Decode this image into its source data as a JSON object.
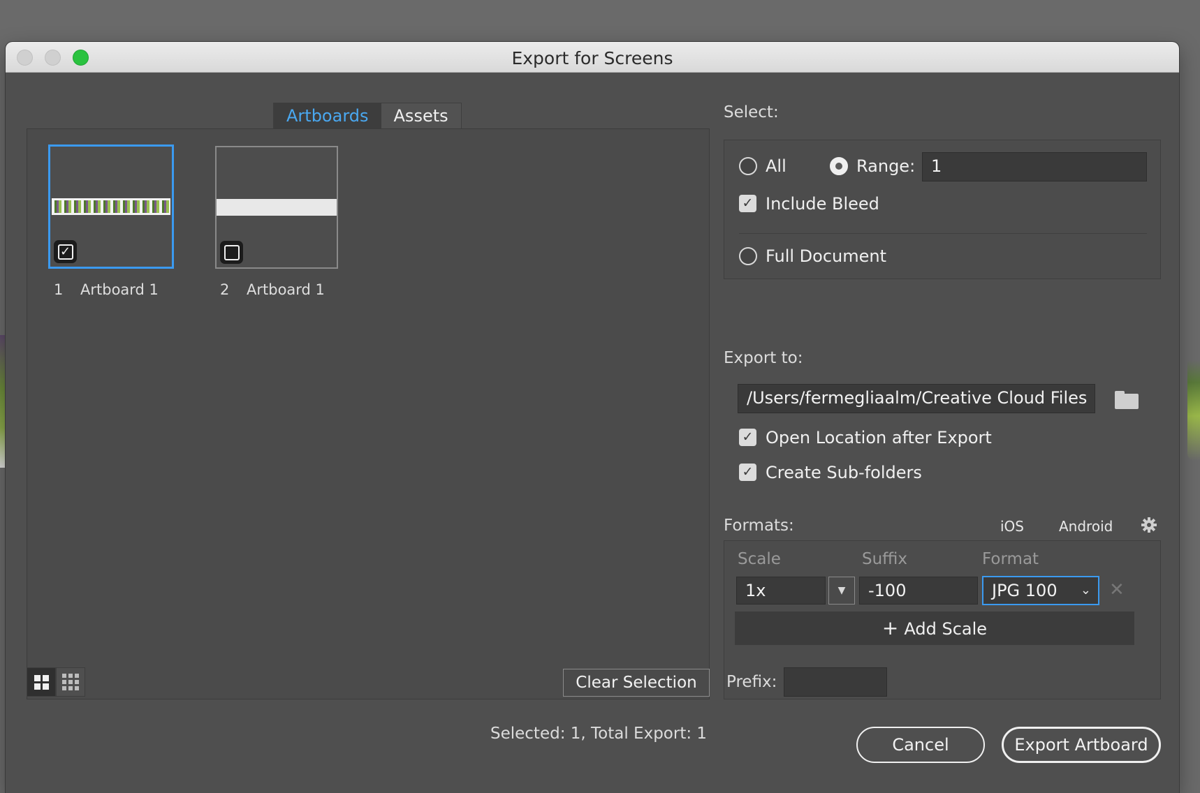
{
  "window": {
    "title": "Export for Screens"
  },
  "tabs": [
    {
      "label": "Artboards",
      "active": true
    },
    {
      "label": "Assets",
      "active": false
    }
  ],
  "artboards": [
    {
      "number": "1",
      "name": "Artboard 1",
      "checked": true
    },
    {
      "number": "2",
      "name": "Artboard 1",
      "checked": false
    }
  ],
  "select": {
    "label": "Select:",
    "all_label": "All",
    "range_label": "Range:",
    "range_value": "1",
    "include_bleed_label": "Include Bleed",
    "full_document_label": "Full Document"
  },
  "export_to": {
    "label": "Export to:",
    "path": "/Users/fermegliaalm/Creative Cloud Files",
    "open_location_label": "Open Location after Export",
    "sub_folders_label": "Create Sub-folders"
  },
  "formats": {
    "label": "Formats:",
    "ios_label": "iOS",
    "android_label": "Android",
    "columns": {
      "scale": "Scale",
      "suffix": "Suffix",
      "format": "Format"
    },
    "row": {
      "scale": "1x",
      "suffix": "-100",
      "format": "JPG 100"
    },
    "add_scale_label": "Add Scale"
  },
  "footer": {
    "clear_selection_label": "Clear Selection",
    "prefix_label": "Prefix:",
    "prefix_value": "",
    "status": "Selected: 1, Total Export: 1",
    "cancel_label": "Cancel",
    "export_label": "Export Artboard"
  },
  "icons": {
    "check": "✓",
    "plus": "+",
    "remove": "✕",
    "dropdown": "▼",
    "chevron": "⌄"
  },
  "colors": {
    "accent": "#3b9af0",
    "window_bg": "#4f4f4f",
    "traffic_green": "#2ac23f"
  }
}
